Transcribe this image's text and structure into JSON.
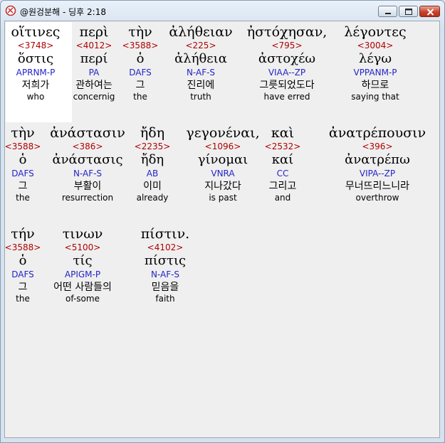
{
  "window": {
    "title": "@원겅분해 - 딩후 2:18",
    "buttons": {
      "minimize": "minimize",
      "maximize": "maximize",
      "close": "close"
    }
  },
  "colors": {
    "strong": "#b00000",
    "parse": "#2424c8",
    "text": "#000000"
  },
  "rows": [
    [
      {
        "greek": "οἵτινες",
        "strong": "<3748>",
        "lemma": "ὅστις",
        "parse": "APRNM-P",
        "kor": "저희가",
        "eng": "who"
      },
      {
        "greek": "περὶ",
        "strong": "<4012>",
        "lemma": "περί",
        "parse": "PA",
        "kor": "관하여는",
        "eng": "concernig"
      },
      {
        "greek": "τὴν",
        "strong": "<3588>",
        "lemma": "ὁ",
        "parse": "DAFS",
        "kor": "그",
        "eng": "the"
      },
      {
        "greek": "ἀλήθειαν",
        "strong": "<225>",
        "lemma": "ἀλήθεια",
        "parse": "N-AF-S",
        "kor": "진리에",
        "eng": "truth"
      },
      {
        "greek": "ἠστόχησαν,",
        "strong": "<795>",
        "lemma": "ἀστοχέω",
        "parse": "VIAA--ZP",
        "kor": "그릇되었도다",
        "eng": "have erred"
      },
      {
        "greek": "λέγοντες",
        "strong": "<3004>",
        "lemma": "λέγω",
        "parse": "VPPANM-P",
        "kor": "하므로",
        "eng": "saying that"
      }
    ],
    [
      {
        "greek": "τὴν",
        "strong": "<3588>",
        "lemma": "ὁ",
        "parse": "DAFS",
        "kor": "그",
        "eng": "the"
      },
      {
        "greek": "ἀνάστασιν",
        "strong": "<386>",
        "lemma": "ἀνάστασις",
        "parse": "N-AF-S",
        "kor": "부활이",
        "eng": "resurrection"
      },
      {
        "greek": "ἤδη",
        "strong": "<2235>",
        "lemma": "ἤδη",
        "parse": "AB",
        "kor": "이미",
        "eng": "already"
      },
      {
        "greek": "γεγονέναι,",
        "strong": "<1096>",
        "lemma": "γίνομαι",
        "parse": "VNRA",
        "kor": "지나갔다",
        "eng": "is past"
      },
      {
        "greek": "καὶ",
        "strong": "<2532>",
        "lemma": "καί",
        "parse": "CC",
        "kor": "그리고",
        "eng": "and"
      },
      {
        "greek": "ἀνατρέπουσιν",
        "strong": "<396>",
        "lemma": "ἀνατρέπω",
        "parse": "VIPA--ZP",
        "kor": "무너뜨리느니라",
        "eng": "overthrow"
      }
    ],
    [
      {
        "greek": "τήν",
        "strong": "<3588>",
        "lemma": "ὁ",
        "parse": "DAFS",
        "kor": "그",
        "eng": "the"
      },
      {
        "greek": "τινων",
        "strong": "<5100>",
        "lemma": "τίς",
        "parse": "APIGM-P",
        "kor": "어떤 사람들의",
        "eng": "of-some"
      },
      {
        "greek": "πίστιν.",
        "strong": "<4102>",
        "lemma": "πίστις",
        "parse": "N-AF-S",
        "kor": "믿음을",
        "eng": "faith"
      }
    ]
  ]
}
